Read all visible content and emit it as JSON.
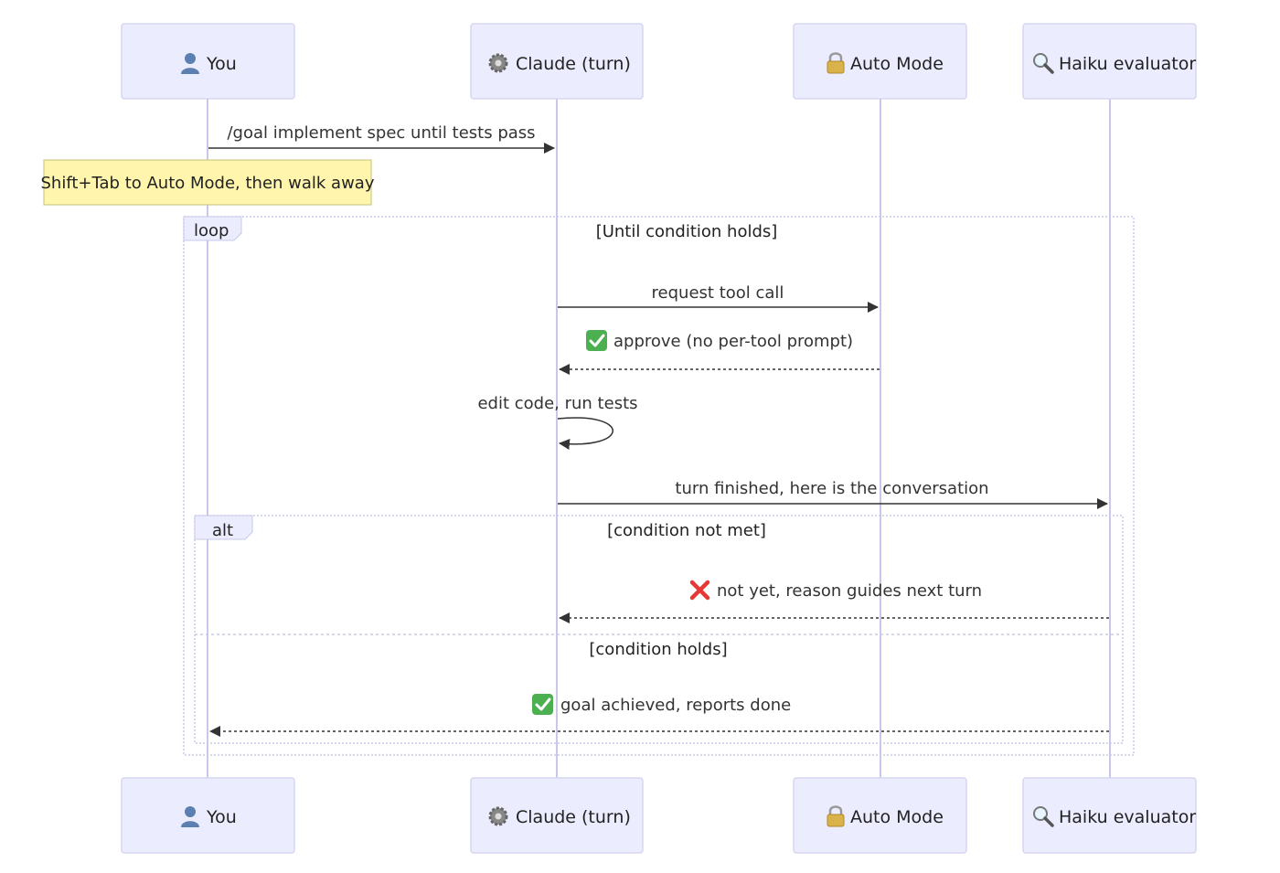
{
  "actors": [
    {
      "label": "You",
      "icon": "person-icon"
    },
    {
      "label": "Claude (turn)",
      "icon": "gear-icon"
    },
    {
      "label": "Auto Mode",
      "icon": "lock-icon"
    },
    {
      "label": "Haiku evaluator",
      "icon": "magnifier-icon"
    }
  ],
  "messages": {
    "goal": "/goal implement spec until tests pass",
    "request": "request tool call",
    "approve": "approve (no per-tool prompt)",
    "edit": "edit code, run tests",
    "turn_finished": "turn finished, here is the conversation",
    "not_yet": "not yet, reason guides next turn",
    "achieved": "goal achieved, reports done"
  },
  "note": "Shift+Tab to Auto Mode, then walk away",
  "frames": {
    "loop_label": "loop",
    "loop_condition": "[Until condition holds]",
    "alt_label": "alt",
    "alt_condition_1": "[condition not met]",
    "alt_condition_2": "[condition holds]"
  },
  "colors": {
    "actor_fill": "#ececff",
    "actor_stroke": "#d6d6f0",
    "lifeline": "#c8c8ee",
    "note_fill": "#fff5ad",
    "note_stroke": "#cccc88",
    "frame_stroke": "#c8c8e8",
    "arrow": "#333333",
    "check_green": "#4caf50",
    "cross_red": "#e53935"
  }
}
